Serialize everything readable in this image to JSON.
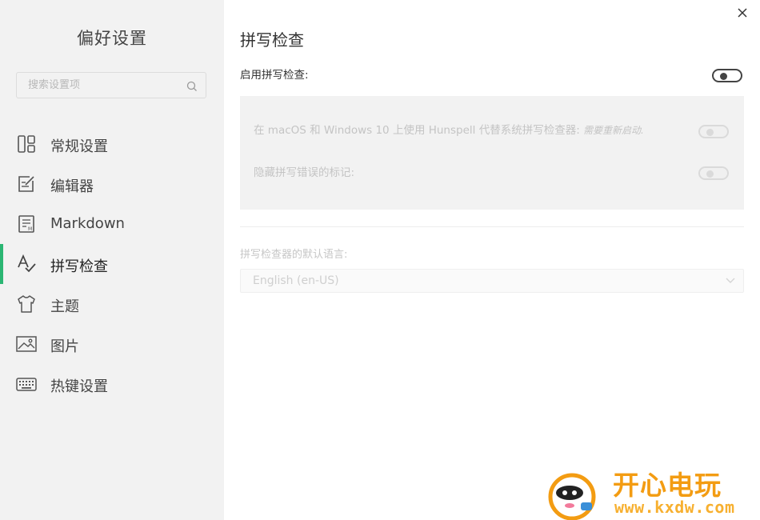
{
  "sidebar": {
    "title": "偏好设置",
    "search": {
      "placeholder": "搜索设置项",
      "value": ""
    },
    "items": [
      {
        "label": "常规设置",
        "icon": "general-settings-icon",
        "active": false
      },
      {
        "label": "编辑器",
        "icon": "editor-icon",
        "active": false
      },
      {
        "label": "Markdown",
        "icon": "markdown-icon",
        "active": false
      },
      {
        "label": "拼写检查",
        "icon": "spellcheck-icon",
        "active": true
      },
      {
        "label": "主题",
        "icon": "theme-shirt-icon",
        "active": false
      },
      {
        "label": "图片",
        "icon": "image-icon",
        "active": false
      },
      {
        "label": "热键设置",
        "icon": "keyboard-icon",
        "active": false
      }
    ],
    "accent_color": "#2bb673"
  },
  "main": {
    "title": "拼写检查",
    "enable_spellcheck": {
      "label": "启用拼写检查:",
      "on": false
    },
    "options": [
      {
        "label": "在 macOS 和 Windows 10 上使用 Hunspell 代替系统拼写检查器:",
        "note": "需要重新启动.",
        "on": false,
        "disabled": true
      },
      {
        "label": "隐藏拼写错误的标记:",
        "note": "",
        "on": false,
        "disabled": true
      }
    ],
    "default_language": {
      "label": "拼写检查器的默认语言:",
      "value": "English (en-US)",
      "disabled": true
    }
  },
  "watermark": {
    "text": "开心电玩",
    "url": "www.kxdw.com",
    "color": "#f39c12"
  }
}
